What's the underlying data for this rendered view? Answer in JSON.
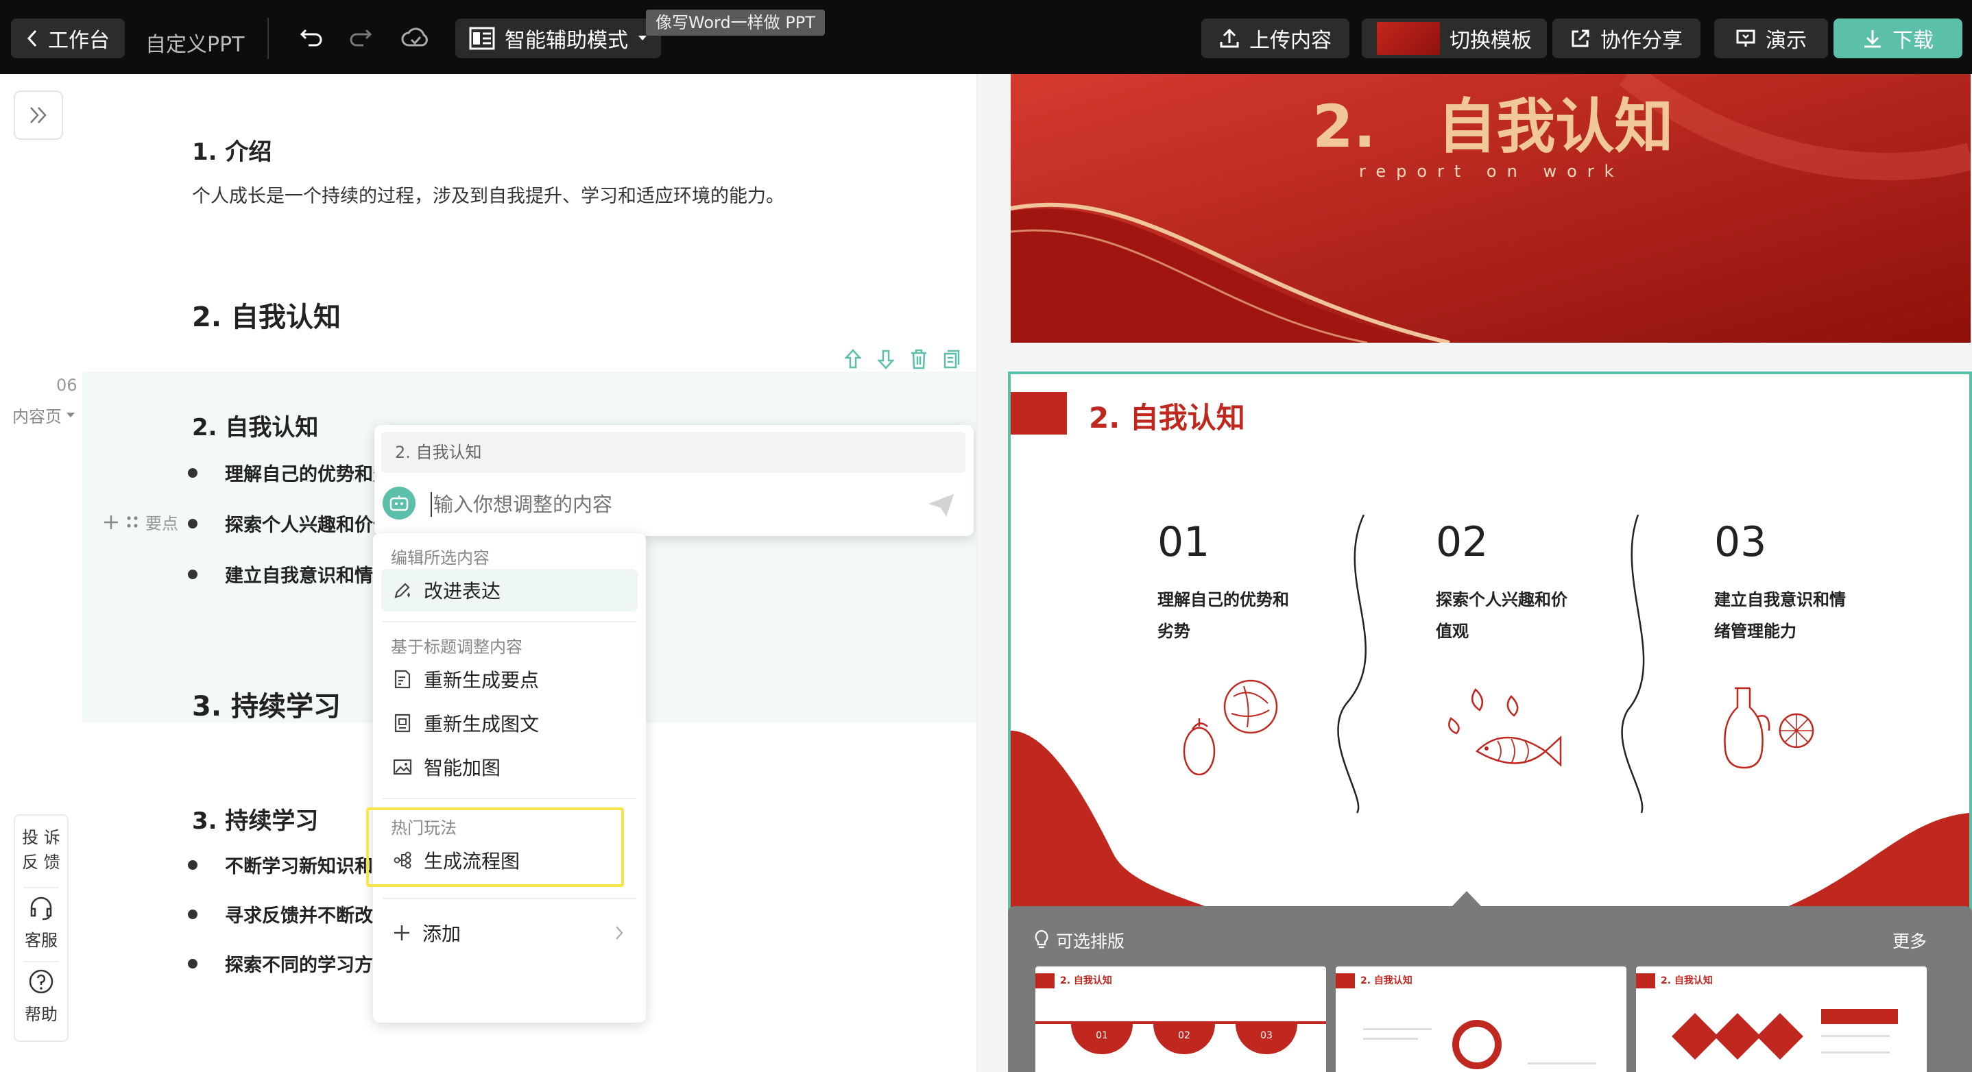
{
  "topbar": {
    "back_label": "工作台",
    "doc_title": "自定义PPT",
    "mode_label": "智能辅助模式",
    "mode_tooltip": "像写Word一样做 PPT",
    "upload_label": "上传内容",
    "template_label": "切换模板",
    "share_label": "协作分享",
    "present_label": "演示",
    "download_label": "下载"
  },
  "editor": {
    "sec1_title": "1. 介绍",
    "sec1_text": "个人成长是一个持续的过程，涉及到自我提升、学习和适应环境的能力。",
    "sec2_title": "2. 自我认知",
    "page_num": "06",
    "page_type": "内容页",
    "block_title": "2. 自我认知",
    "point_tag": "要点",
    "points": [
      "理解自己的优势和劣势",
      "探索个人兴趣和价值观",
      "建立自我意识和情绪管理能力"
    ],
    "sec3_title": "3. 持续学习",
    "sec3_sub": "3. 持续学习",
    "sec3_points": [
      "不断学习新知识和技能",
      "寻求反馈并不断改进",
      "探索不同的学习方法和资源"
    ]
  },
  "ai_popup": {
    "context_label": "2. 自我认知",
    "input_placeholder": "输入你想调整的内容",
    "section_edit": "编辑所选内容",
    "improve": "改进表达",
    "section_title_based": "基于标题调整内容",
    "regen_points": "重新生成要点",
    "regen_image_text": "重新生成图文",
    "smart_image": "智能加图",
    "section_hot": "热门玩法",
    "gen_flowchart": "生成流程图",
    "add": "添加"
  },
  "sidebar_tools": {
    "feedback": "投 诉\n反 馈",
    "service": "客服",
    "help": "帮助"
  },
  "slide_top": {
    "title": "2.   自我认知",
    "subtitle": "report on work"
  },
  "slide_main": {
    "title": "2. 自我认知",
    "items": [
      {
        "num": "01",
        "text_line1": "理解自己的优势和",
        "text_line2": "劣势"
      },
      {
        "num": "02",
        "text_line1": "探索个人兴趣和价",
        "text_line2": "值观"
      },
      {
        "num": "03",
        "text_line1": "建立自我意识和情",
        "text_line2": "绪管理能力"
      }
    ]
  },
  "layout_panel": {
    "title": "可选排版",
    "more": "更多",
    "thumb_title": "2. 自我认知",
    "thumb_nums": [
      "01",
      "02",
      "03"
    ]
  },
  "colors": {
    "accent_teal": "#5bbfa9",
    "slide_red": "#c0271f",
    "topbar_bg": "#0d0d0d",
    "highlight_yellow": "#f4e64a"
  }
}
